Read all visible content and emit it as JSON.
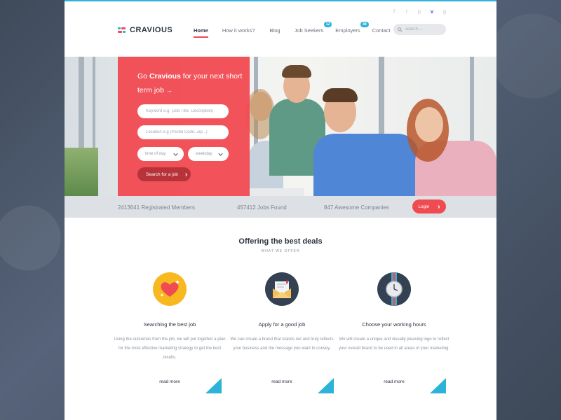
{
  "brand": {
    "name": "CRAVIOUS"
  },
  "social": [
    "f",
    "t",
    "p",
    "v",
    "g"
  ],
  "nav": {
    "items": [
      {
        "label": "Home",
        "active": true
      },
      {
        "label": "How it works?"
      },
      {
        "label": "Blog"
      },
      {
        "label": "Job Seekers",
        "badge": "12"
      },
      {
        "label": "Employers",
        "badge": "48"
      },
      {
        "label": "Contact"
      }
    ]
  },
  "search": {
    "placeholder": "search ...",
    "icon": "search-icon"
  },
  "hero": {
    "title_prefix": "Go ",
    "title_brand": "Cravious",
    "title_suffix": " for your next short term job",
    "title_arrow": "→",
    "keyword_placeholder": "Keyword e.g. (Job Title, Description)",
    "location_placeholder": "Location e.g (Postal Code, Zip...)",
    "time_select": "time of day",
    "day_select": "weekday",
    "search_button": "Search for a job",
    "button_arrow": "›"
  },
  "stats": {
    "members": "2413641 Registrated Members",
    "jobs": "457412 Jobs Found",
    "companies": "847 Awesome Companies",
    "login_button": "Login",
    "login_arrow": "›"
  },
  "offer": {
    "title": "Offering the best deals",
    "subtitle": "WHAT WE OFFER",
    "cards": [
      {
        "icon": "heart-icon",
        "title": "Searching the best job",
        "text": "Using the outcomes from the job, we will put together a plan for the most effective marketing strategy to get the best results.",
        "more": "read more"
      },
      {
        "icon": "envelope-icon",
        "title": "Apply for a good job",
        "text": "We can create a brand that stands out and truly reflects your business and the message you want to convey.",
        "more": "read more"
      },
      {
        "icon": "watch-icon",
        "title": "Choose your working hours",
        "text": "We will create a unique and visually pleasing logo to reflect your overall brand to be used in all areas of your marketing.",
        "more": "read more"
      }
    ]
  },
  "colors": {
    "accent_red": "#f14b52",
    "accent_blue": "#2db3d8",
    "dark_text": "#2d3440"
  }
}
